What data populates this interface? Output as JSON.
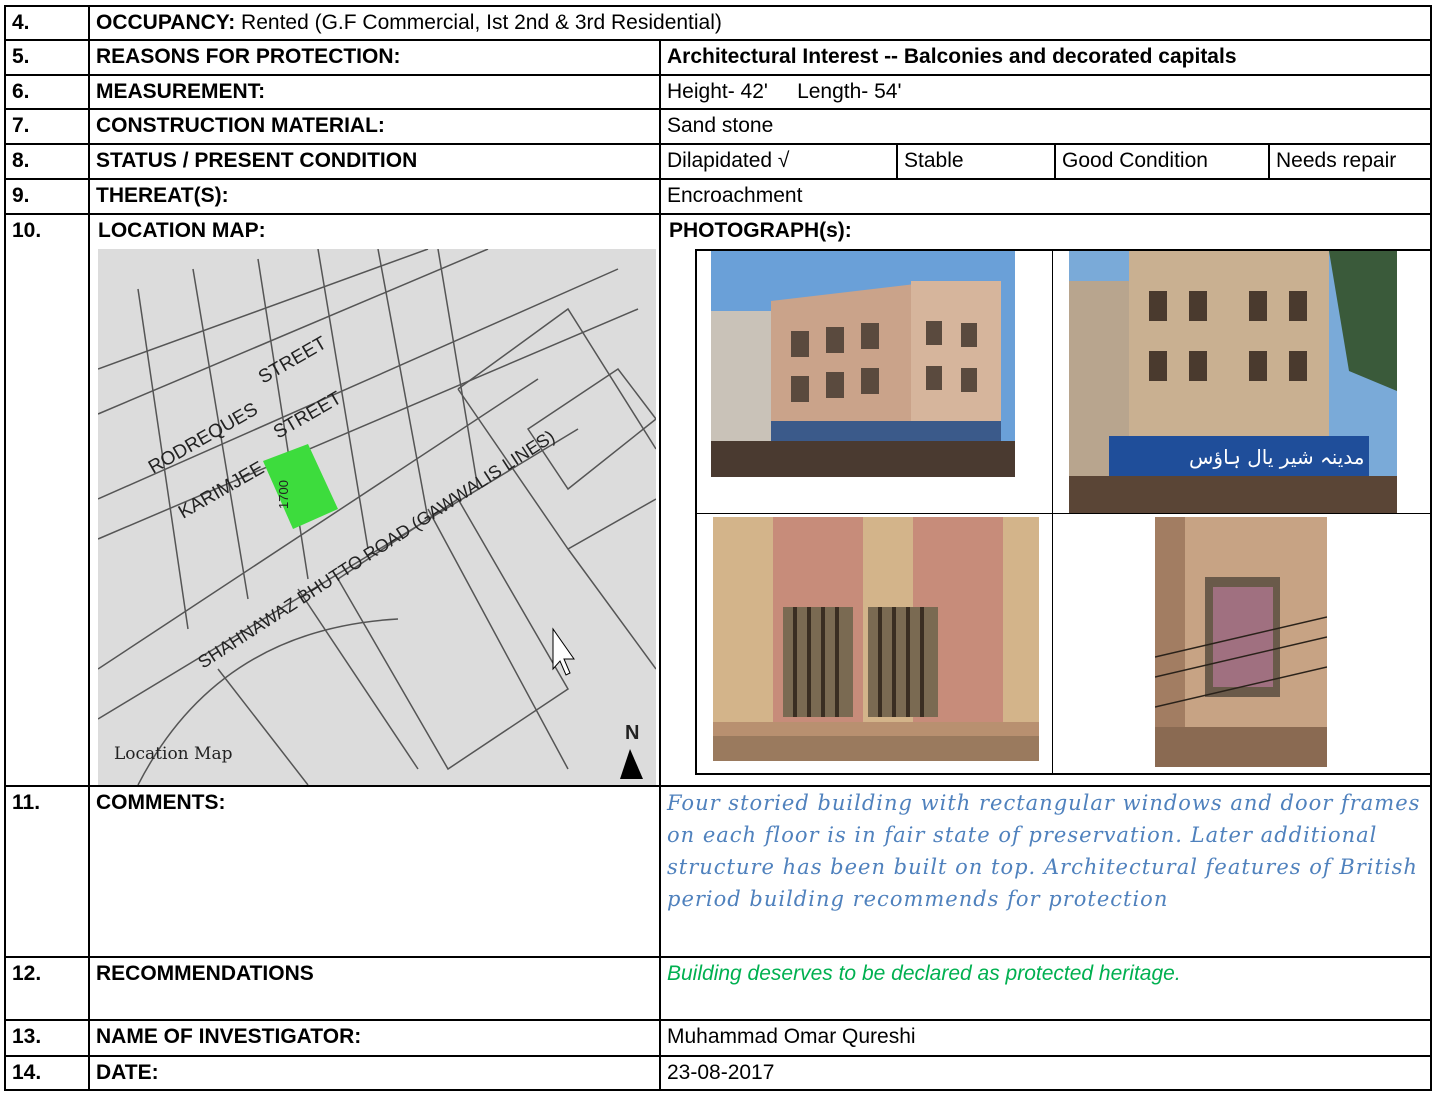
{
  "rows": [
    {
      "num": "4.",
      "label": "OCCUPANCY:",
      "value": " Rented (G.F Commercial, Ist 2nd & 3rd Residential)"
    },
    {
      "num": "5.",
      "label": "REASONS FOR PROTECTION:",
      "value": "Architectural Interest   --  Balconies and decorated capitals"
    },
    {
      "num": "6.",
      "label": "MEASUREMENT:",
      "value": "Height- 42'     Length- 54'"
    },
    {
      "num": "7.",
      "label": "CONSTRUCTION MATERIAL:",
      "value": "Sand stone"
    },
    {
      "num": "8.",
      "label": "STATUS / PRESENT CONDITION",
      "status": [
        "Dilapidated  √",
        "Stable",
        "Good Condition",
        "Needs repair"
      ]
    },
    {
      "num": "9.",
      "label": "THEREAT(S):",
      "value": "Encroachment"
    },
    {
      "num": "10.",
      "label": "LOCATION MAP:",
      "value": "PHOTOGRAPH(s):"
    },
    {
      "num": "11.",
      "label": "COMMENTS:",
      "value": "Four storied building with rectangular windows and door frames on each floor is in fair state of preservation. Later additional structure has been built on top. Architectural features of British period building recommends for protection"
    },
    {
      "num": "12.",
      "label": "RECOMMENDATIONS",
      "value": "Building deserves to be declared as protected heritage."
    },
    {
      "num": "13.",
      "label": "NAME OF INVESTIGATOR:",
      "value": "Muhammad Omar Qureshi"
    },
    {
      "num": "14.",
      "label": "DATE:",
      "value": "23-08-2017"
    }
  ],
  "map": {
    "streets": [
      "RODREQUES",
      "STREET",
      "KARIMJEE",
      "STREET",
      "SHAHNAWAZ BHUTTO ROAD (GAWWALIS LINES)",
      "1700"
    ],
    "caption": "Location Map",
    "north": "N",
    "highlight_color": "#3ddc3d"
  },
  "photos": {
    "signboard_text": "مدینہ شیر یال ہاؤس"
  },
  "colors": {
    "comment": "#4f81bd",
    "recommendation": "#00b050"
  }
}
